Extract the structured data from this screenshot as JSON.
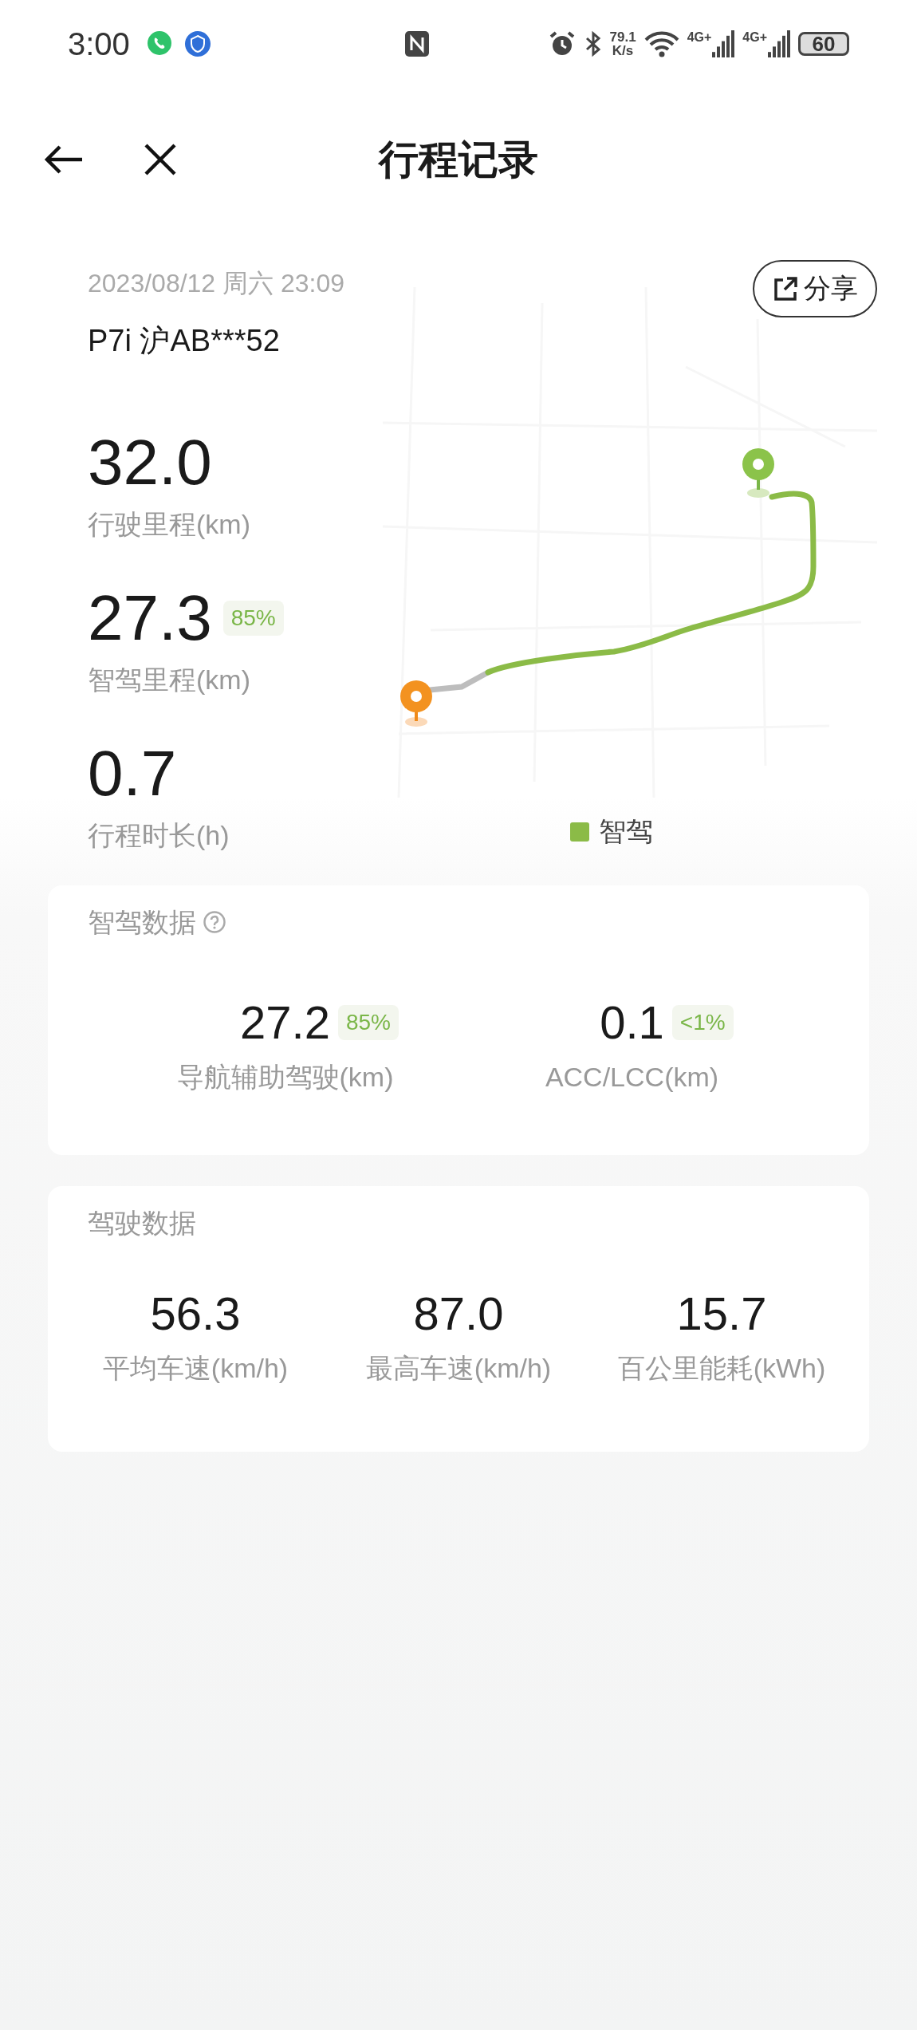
{
  "status_bar": {
    "time": "3:00",
    "net_speed": "79.1",
    "net_speed_unit": "K/s",
    "signal_1": "4G+",
    "signal_2": "4G+",
    "battery": "60"
  },
  "header": {
    "title": "行程记录"
  },
  "trip": {
    "datetime": "2023/08/12 周六 23:09",
    "vehicle": "P7i 沪AB***52",
    "share_label": "分享",
    "stats": [
      {
        "value": "32.0",
        "label": "行驶里程(km)"
      },
      {
        "value": "27.3",
        "label": "智驾里程(km)",
        "badge": "85%"
      },
      {
        "value": "0.7",
        "label": "行程时长(h)"
      }
    ],
    "legend": {
      "label": "智驾",
      "color": "#8bbb47"
    }
  },
  "smart_card": {
    "title": "智驾数据",
    "items": [
      {
        "value": "27.2",
        "label": "导航辅助驾驶(km)",
        "badge": "85%"
      },
      {
        "value": "0.1",
        "label": "ACC/LCC(km)",
        "badge": "<1%"
      }
    ]
  },
  "drive_card": {
    "title": "驾驶数据",
    "items": [
      {
        "value": "56.3",
        "label": "平均车速(km/h)"
      },
      {
        "value": "87.0",
        "label": "最高车速(km/h)"
      },
      {
        "value": "15.7",
        "label": "百公里能耗(kWh)"
      }
    ]
  }
}
